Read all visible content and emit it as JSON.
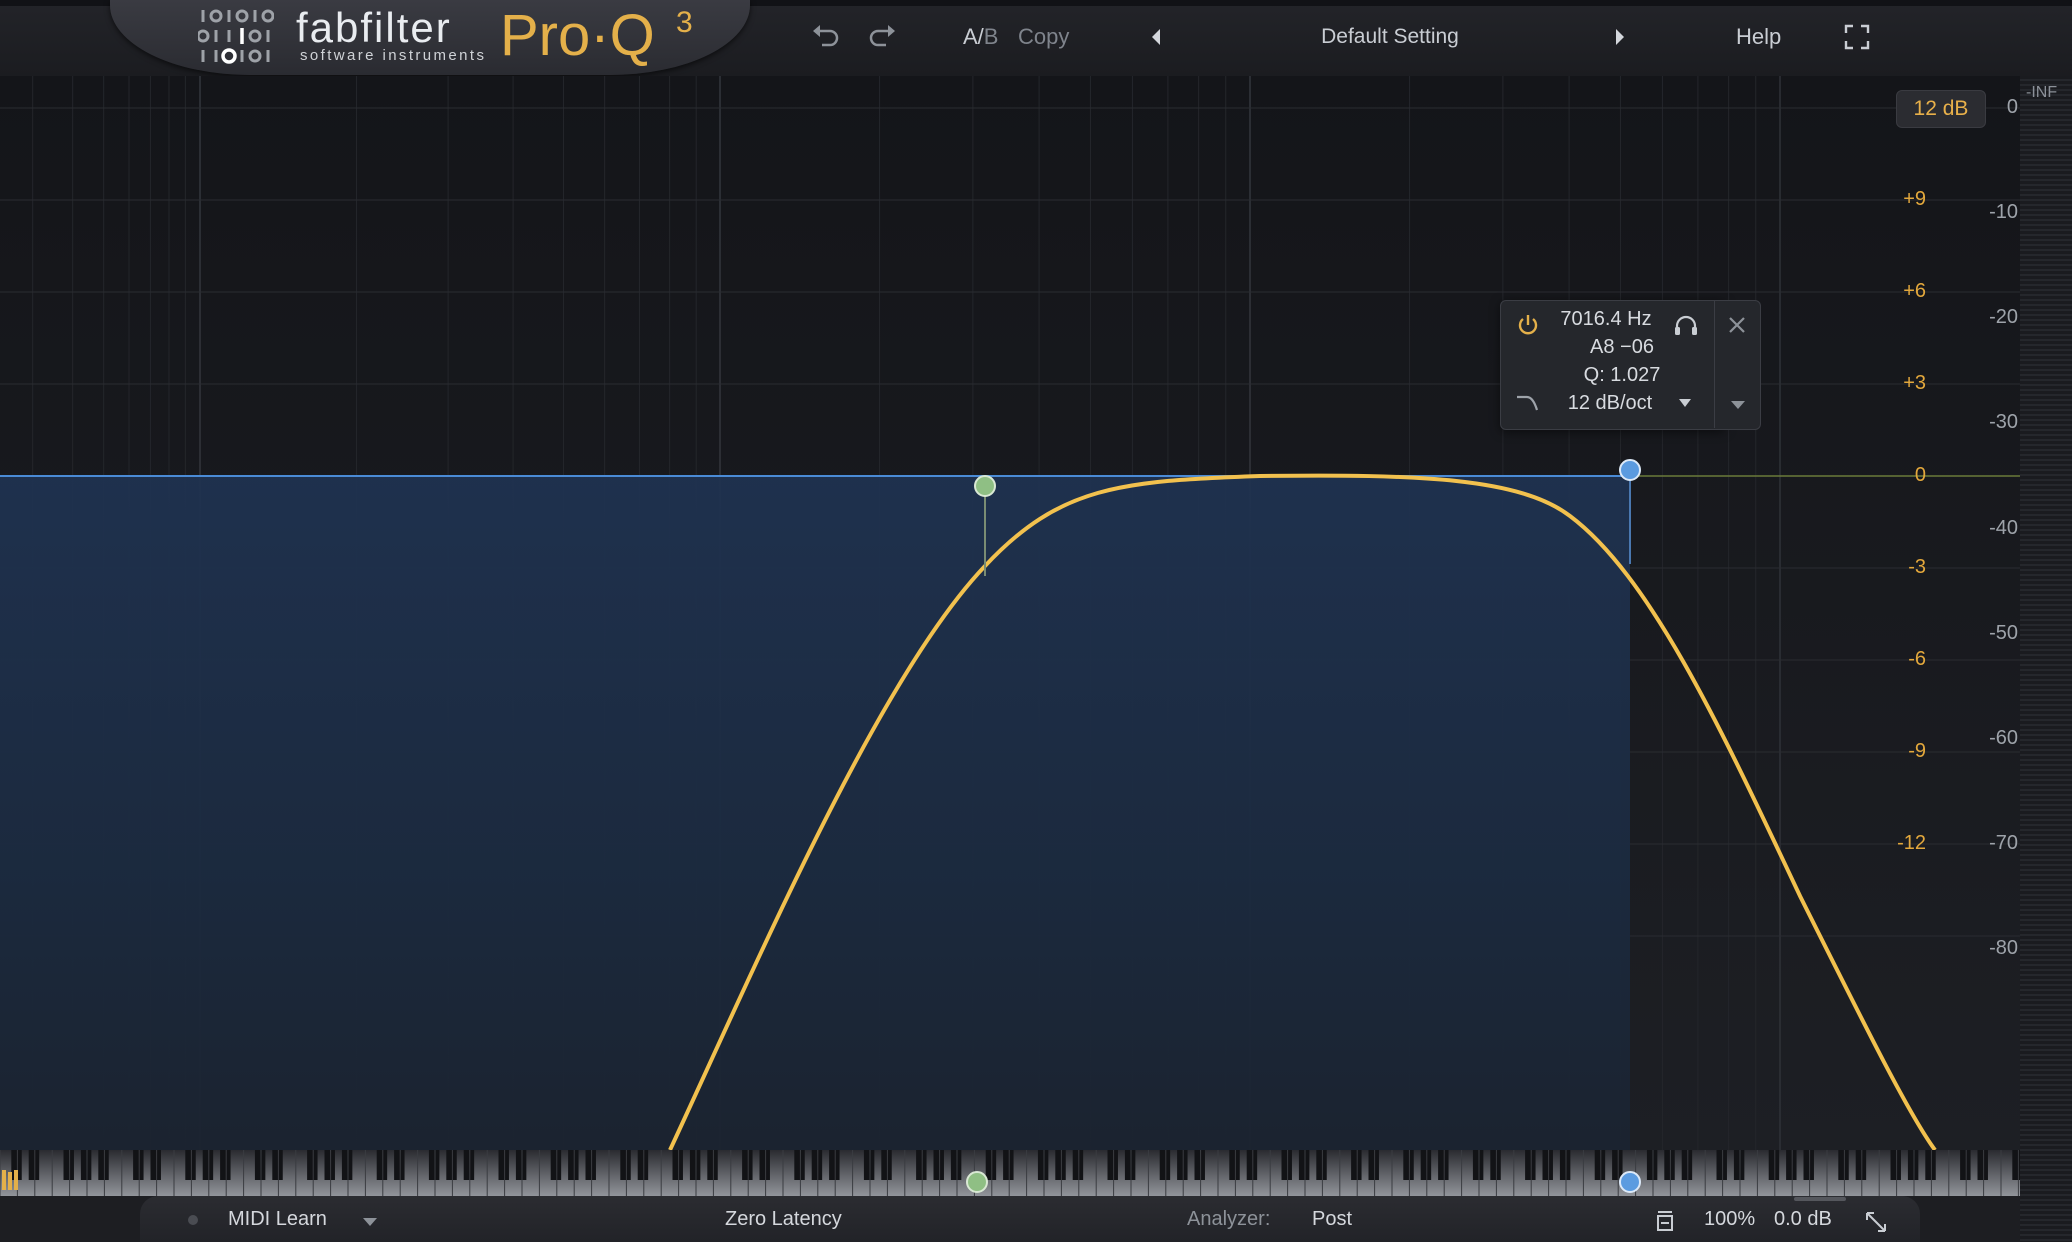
{
  "header": {
    "brand_name": "fabfilter",
    "brand_sub": "software instruments",
    "product_name": "Pro·Q",
    "product_version": "3",
    "ab_a": "A/",
    "ab_b": "B",
    "copy_label": "Copy",
    "preset_name": "Default Setting",
    "help_label": "Help"
  },
  "graph": {
    "range_label": "12 dB",
    "gain_scale": [
      "+9",
      "+6",
      "+3",
      "0",
      "-3",
      "-6",
      "-9",
      "-12"
    ],
    "db_scale": [
      "0",
      "-10",
      "-20",
      "-30",
      "-40",
      "-50",
      "-60",
      "-70",
      "-80"
    ],
    "inf_label": "-INF"
  },
  "band_popup": {
    "frequency": "7016.4 Hz",
    "note": "A8 −06",
    "q": "Q: 1.027",
    "slope": "12 dB/oct"
  },
  "bottom_bar": {
    "midi_learn": "MIDI Learn",
    "latency": "Zero Latency",
    "analyzer_label": "Analyzer:",
    "analyzer_value": "Post",
    "zoom": "100%",
    "output_gain": "0.0 dB"
  },
  "colors": {
    "curve": "#f2c14e",
    "band_low": "#8fbf84",
    "band_high": "#5b9be0",
    "accent": "#e4b04a"
  }
}
